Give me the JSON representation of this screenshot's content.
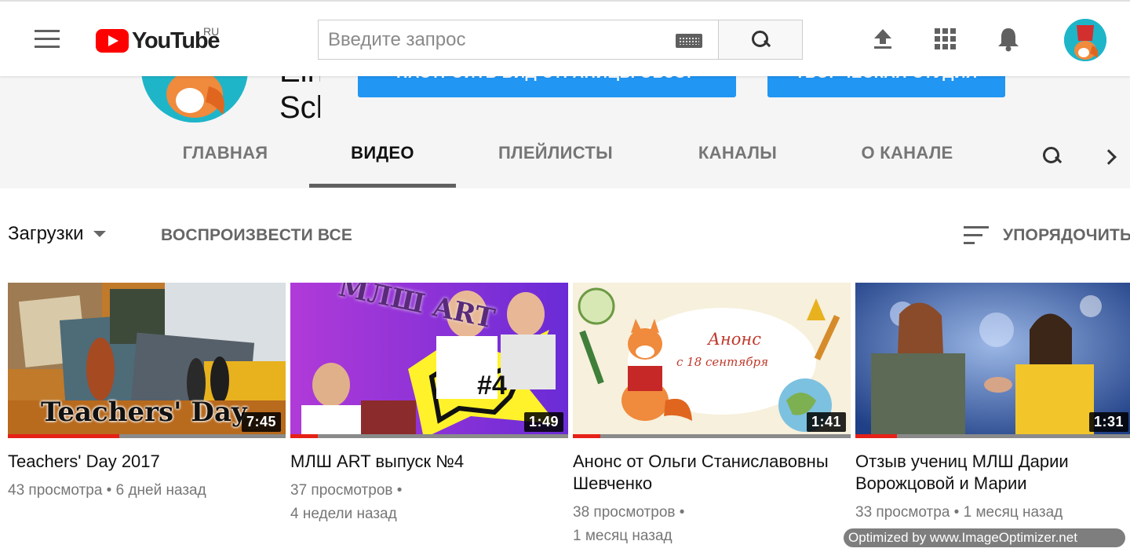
{
  "masthead": {
    "logo_text": "YouTube",
    "region": "RU",
    "search_placeholder": "Введите запрос",
    "icons": [
      "menu-icon",
      "keyboard-icon",
      "search-icon",
      "upload-icon",
      "apps-icon",
      "bell-icon"
    ]
  },
  "channel": {
    "name_visible": "Ein\nSch",
    "customize_label": "НАСТРОИТЬ ВИД СТРАНИЦЫ ОБЗОР",
    "studio_label": "ТВОРЧЕСКАЯ СТУДИЯ"
  },
  "tabs": [
    {
      "label": "ГЛАВНАЯ",
      "active": false
    },
    {
      "label": "ВИДЕО",
      "active": true
    },
    {
      "label": "ПЛЕЙЛИСТЫ",
      "active": false
    },
    {
      "label": "КАНАЛЫ",
      "active": false
    },
    {
      "label": "О КАНАЛЕ",
      "active": false
    }
  ],
  "filter": {
    "uploads_label": "Загрузки",
    "play_all_label": "ВОСПРОИЗВЕСТИ ВСЕ",
    "sort_label": "УПОРЯДОЧИТЬ"
  },
  "videos": [
    {
      "title": "Teachers' Day 2017",
      "views": "43 просмотра",
      "age": "6 дней назад",
      "duration": "7:45",
      "thumb_caption": "Teachers' Day",
      "watched_fraction": 0.4
    },
    {
      "title": "МЛШ ART выпуск №4",
      "views": "37 просмотров",
      "age": "4 недели назад",
      "duration": "1:49",
      "thumb_caption": "МЛШ ART",
      "thumb_badge": "#4",
      "watched_fraction": 0.1
    },
    {
      "title": "Анонс от Ольги Станиславовны Шевченко",
      "views": "38 просмотров",
      "age": "1 месяц назад",
      "duration": "1:41",
      "thumb_caption": "Анонс",
      "thumb_subcaption": "с 18 сентября",
      "watched_fraction": 0.1
    },
    {
      "title": "Отзыв учениц МЛШ Дарии Ворожцовой и Марии",
      "views": "33 просмотра",
      "age": "1 месяц назад",
      "duration": "1:31",
      "watched_fraction": 0.15
    }
  ],
  "watermark": "Optimized by www.ImageOptimizer.net",
  "colors": {
    "brand_red": "#ff0000",
    "button_blue": "#2196f3",
    "progress_red": "#e62117"
  }
}
